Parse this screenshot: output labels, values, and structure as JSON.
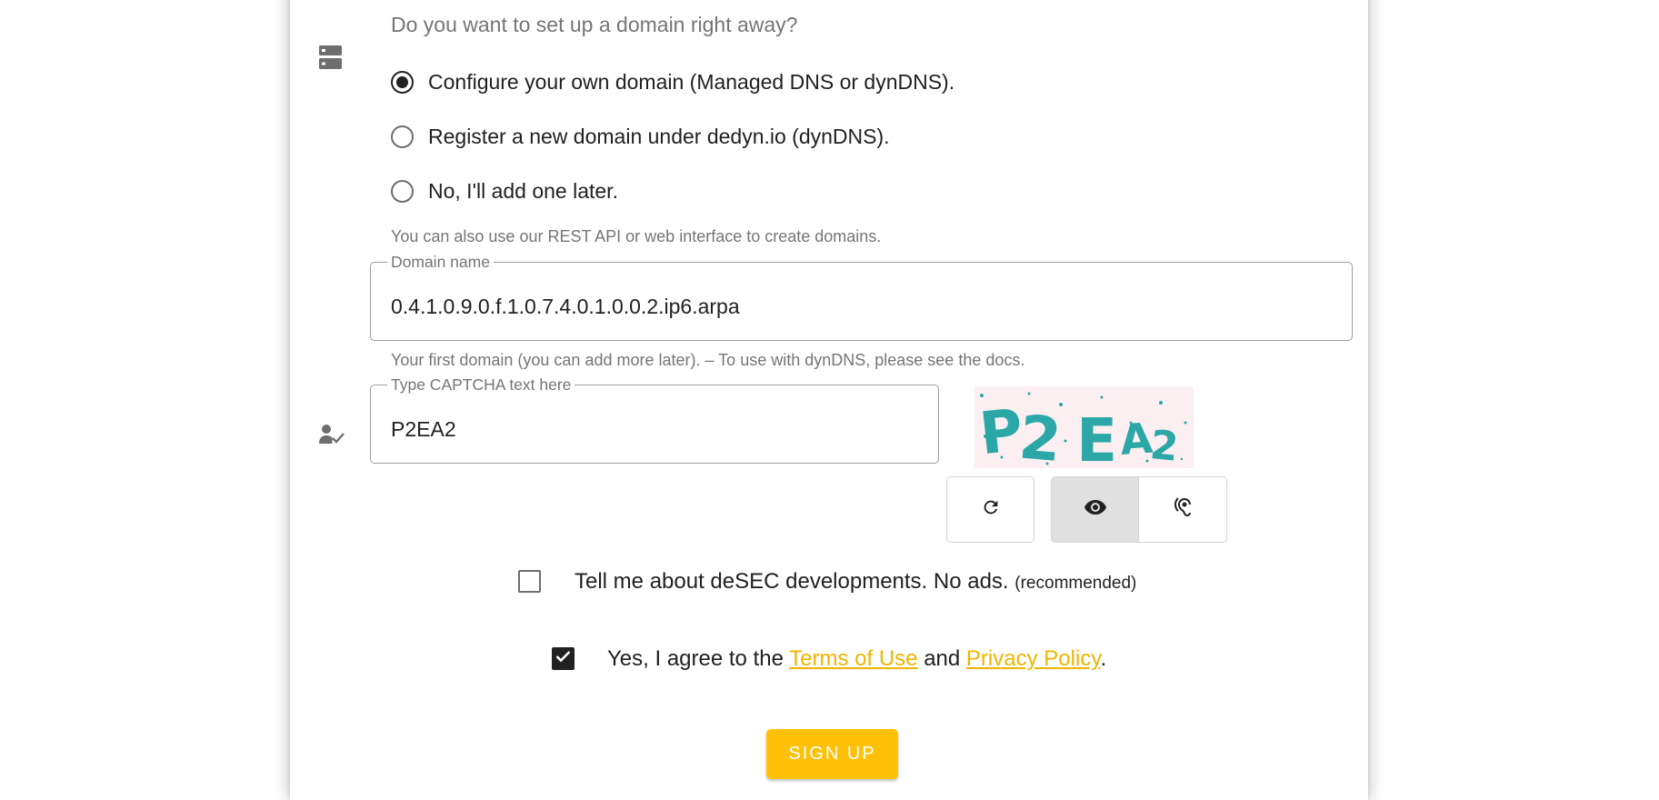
{
  "domain_setup": {
    "question": "Do you want to set up a domain right away?",
    "options": [
      {
        "label": "Configure your own domain (Managed DNS or dynDNS).",
        "selected": true
      },
      {
        "label": "Register a new domain under dedyn.io (dynDNS).",
        "selected": false
      },
      {
        "label": "No, I'll add one later.",
        "selected": false
      }
    ],
    "hint": "You can also use our REST API or web interface to create domains."
  },
  "domain_field": {
    "label": "Domain name",
    "value": "0.4.1.0.9.0.f.1.0.7.4.0.1.0.0.2.ip6.arpa",
    "hint": "Your first domain (you can add more later). – To use with dynDNS, please see the docs."
  },
  "captcha": {
    "label": "Type CAPTCHA text here",
    "value": "P2EA2",
    "image_text": "P2EA2",
    "image_color": "#2aa7a6",
    "image_background": "#fbeff1",
    "buttons": [
      {
        "icon": "refresh-icon",
        "active": false
      },
      {
        "icon": "eye-icon",
        "active": true
      },
      {
        "icon": "ear-icon",
        "active": false
      }
    ]
  },
  "newsletter": {
    "label": "Tell me about deSEC developments. No ads.",
    "note": "(recommended)",
    "checked": false
  },
  "terms": {
    "prefix": "Yes, I agree to the",
    "terms_link": "Terms of Use",
    "conjunction": "and",
    "privacy_link": "Privacy Policy",
    "suffix": ".",
    "checked": true
  },
  "submit": {
    "label": "SIGN UP"
  },
  "colors": {
    "accent": "#ffc107",
    "link": "#f0b400",
    "text": "#212121",
    "muted": "#757575"
  }
}
